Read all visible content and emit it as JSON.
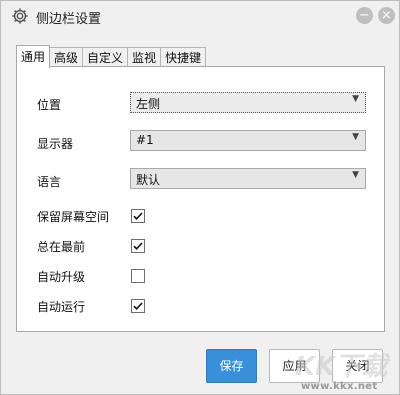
{
  "window": {
    "title": "侧边栏设置"
  },
  "tabs": [
    {
      "label": "通用",
      "active": true
    },
    {
      "label": "高级",
      "active": false
    },
    {
      "label": "自定义",
      "active": false
    },
    {
      "label": "监视",
      "active": false
    },
    {
      "label": "快捷键",
      "active": false
    }
  ],
  "general": {
    "position": {
      "label": "位置",
      "value": "左侧"
    },
    "display": {
      "label": "显示器",
      "value": "#1"
    },
    "language": {
      "label": "语言",
      "value": "默认"
    },
    "checks": [
      {
        "label": "保留屏幕空间",
        "checked": true
      },
      {
        "label": "总在最前",
        "checked": true
      },
      {
        "label": "自动升级",
        "checked": false
      },
      {
        "label": "自动运行",
        "checked": true
      }
    ]
  },
  "buttons": {
    "save": "保存",
    "apply": "应用",
    "close": "关闭"
  },
  "watermark": {
    "text": "www.kkx.net"
  },
  "icons": {
    "settings": "gear-icon",
    "minimize": "minus-icon",
    "close": "close-icon",
    "dropdown": "chevron-down-icon",
    "check": "checkmark-icon"
  },
  "colors": {
    "primary_button": "#3a8fd9",
    "window_bg": "#f0f0f0",
    "panel_bg": "#ffffff"
  }
}
